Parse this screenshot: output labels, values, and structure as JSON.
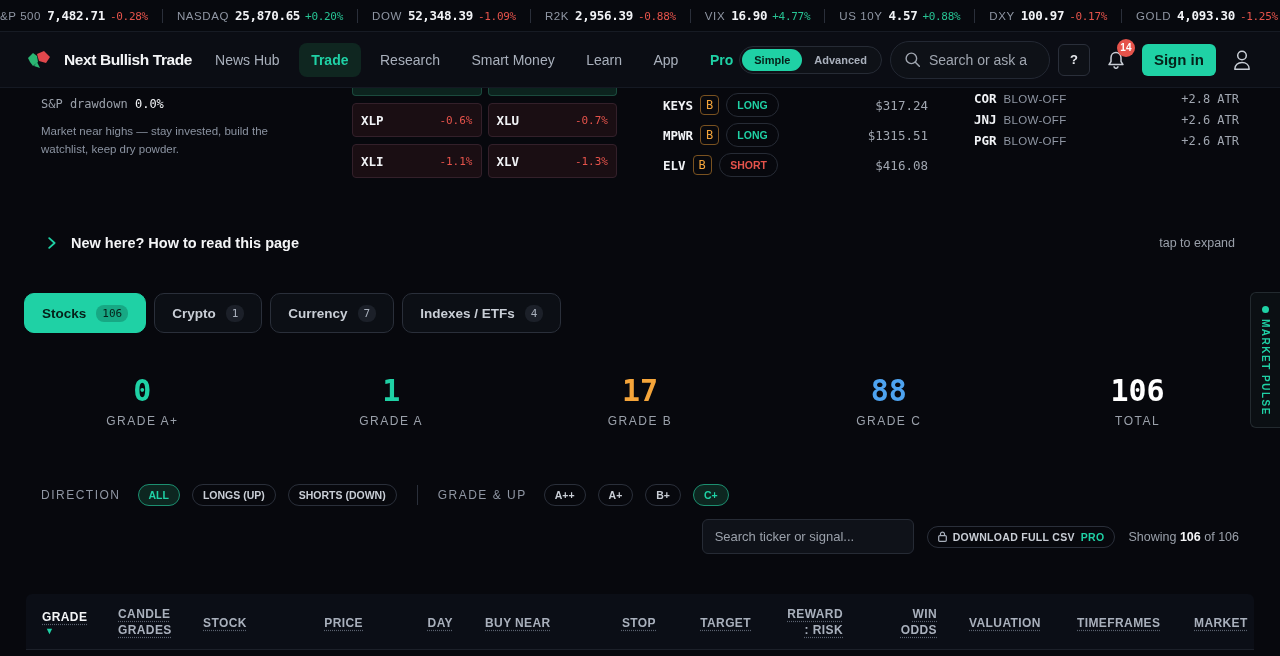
{
  "ticker": [
    {
      "label": "&P 500",
      "value": "7,482.71",
      "change": "-0.28%",
      "rising": false
    },
    {
      "label": "NASDAQ",
      "value": "25,870.65",
      "change": "+0.20%",
      "rising": true
    },
    {
      "label": "DOW",
      "value": "52,348.39",
      "change": "-1.09%",
      "rising": false
    },
    {
      "label": "R2K",
      "value": "2,956.39",
      "change": "-0.88%",
      "rising": false
    },
    {
      "label": "VIX",
      "value": "16.90",
      "change": "+4.77%",
      "rising": true
    },
    {
      "label": "US 10Y",
      "value": "4.57",
      "change": "+0.88%",
      "rising": true
    },
    {
      "label": "DXY",
      "value": "100.97",
      "change": "-0.17%",
      "rising": false
    },
    {
      "label": "GOLD",
      "value": "4,093.30",
      "change": "-1.25%",
      "rising": false
    }
  ],
  "nav": {
    "brand": "Next Bullish Trade",
    "links": [
      {
        "label": "News Hub",
        "kind": "link",
        "selected": false
      },
      {
        "label": "Trade",
        "kind": "link",
        "selected": true
      },
      {
        "label": "Research",
        "kind": "link",
        "selected": false
      },
      {
        "label": "Smart Money",
        "kind": "link",
        "selected": false
      },
      {
        "label": "Learn",
        "kind": "link",
        "selected": false
      },
      {
        "label": "App",
        "kind": "link",
        "selected": false
      },
      {
        "label": "Pro",
        "kind": "pro",
        "selected": false
      }
    ],
    "mode_toggle": [
      {
        "label": "Simple",
        "selected": true
      },
      {
        "label": "Advanced",
        "selected": false
      }
    ],
    "search": {
      "placeholder": "Search or ask a"
    },
    "help_button": "?",
    "notifications": {
      "count": "14"
    },
    "sign_in_button": "Sign in"
  },
  "market_summary": {
    "drawdown_label": "S&P drawdown",
    "drawdown_value": "0.0%",
    "note": "Market near highs — stay invested, build the watchlist, keep dry powder."
  },
  "sectors_cut_off": [
    {
      "rising": true
    },
    {
      "rising": true
    }
  ],
  "sectors": [
    {
      "symbol": "XLP",
      "change": "-0.6%",
      "rising": false
    },
    {
      "symbol": "XLU",
      "change": "-0.7%",
      "rising": false
    },
    {
      "symbol": "XLI",
      "change": "-1.1%",
      "rising": false
    },
    {
      "symbol": "XLV",
      "change": "-1.3%",
      "rising": false
    }
  ],
  "setups": [
    {
      "ticker": "KEYS",
      "grade": "B",
      "direction": "LONG",
      "kind": "long",
      "price": "$317.24"
    },
    {
      "ticker": "MPWR",
      "grade": "B",
      "direction": "LONG",
      "kind": "long",
      "price": "$1315.51"
    },
    {
      "ticker": "ELV",
      "grade": "B",
      "direction": "SHORT",
      "kind": "short",
      "price": "$416.08"
    }
  ],
  "blow_offs": [
    {
      "ticker": "COR",
      "signal": "BLOW-OFF",
      "move": "+2.8 ATR"
    },
    {
      "ticker": "JNJ",
      "signal": "BLOW-OFF",
      "move": "+2.6 ATR"
    },
    {
      "ticker": "PGR",
      "signal": "BLOW-OFF",
      "move": "+2.6 ATR"
    }
  ],
  "explainer": {
    "title": "New here? How to read this page",
    "expanded": false,
    "hint": "tap to expand"
  },
  "asset_tabs": [
    {
      "label": "Stocks",
      "count": "106",
      "selected": true
    },
    {
      "label": "Crypto",
      "count": "1",
      "selected": false
    },
    {
      "label": "Currency",
      "count": "7",
      "selected": false
    },
    {
      "label": "Indexes / ETFs",
      "count": "4",
      "selected": false
    }
  ],
  "market_pulse_tab": {
    "label": "MARKET PULSE"
  },
  "grade_summary": [
    {
      "value": "0",
      "label": "GRADE A+",
      "color": "#1fd1a5"
    },
    {
      "value": "1",
      "label": "GRADE A",
      "color": "#1fd1a5"
    },
    {
      "value": "17",
      "label": "GRADE B",
      "color": "#f5a53a"
    },
    {
      "value": "88",
      "label": "GRADE C",
      "color": "#4ea3f0"
    },
    {
      "value": "106",
      "label": "TOTAL",
      "color": "#ffffff"
    }
  ],
  "filters": [
    {
      "label": "DIRECTION",
      "options": [
        {
          "label": "ALL",
          "selected": true
        },
        {
          "label": "LONGS (UP)",
          "selected": false
        },
        {
          "label": "SHORTS (DOWN)",
          "selected": false
        }
      ]
    },
    {
      "label": "GRADE & UP",
      "options": [
        {
          "label": "A++",
          "selected": false
        },
        {
          "label": "A+",
          "selected": false
        },
        {
          "label": "B+",
          "selected": false
        },
        {
          "label": "C+",
          "selected": true
        }
      ]
    }
  ],
  "toolbar": {
    "search": {
      "placeholder": "Search ticker or signal..."
    },
    "download_button": {
      "label": "DOWNLOAD FULL CSV",
      "badge": "PRO"
    },
    "showing": "Showing **106** of 106"
  },
  "table": {
    "columns": [
      {
        "label": "GRADE",
        "selected": true,
        "sort_indicator": "▼"
      },
      {
        "label": "CANDLE GRADES",
        "selected": false
      },
      {
        "label": "STOCK",
        "selected": false
      },
      {
        "label": "PRICE",
        "selected": false
      },
      {
        "label": "DAY",
        "selected": false
      },
      {
        "label": "BUY NEAR",
        "selected": false
      },
      {
        "label": "STOP",
        "selected": false
      },
      {
        "label": "TARGET",
        "selected": false
      },
      {
        "label": "REWARD : RISK",
        "selected": false
      },
      {
        "label": "WIN ODDS",
        "selected": false
      },
      {
        "label": "VALUATION",
        "selected": false
      },
      {
        "label": "TIMEFRAMES",
        "selected": false
      },
      {
        "label": "MARKET",
        "selected": false
      }
    ]
  }
}
